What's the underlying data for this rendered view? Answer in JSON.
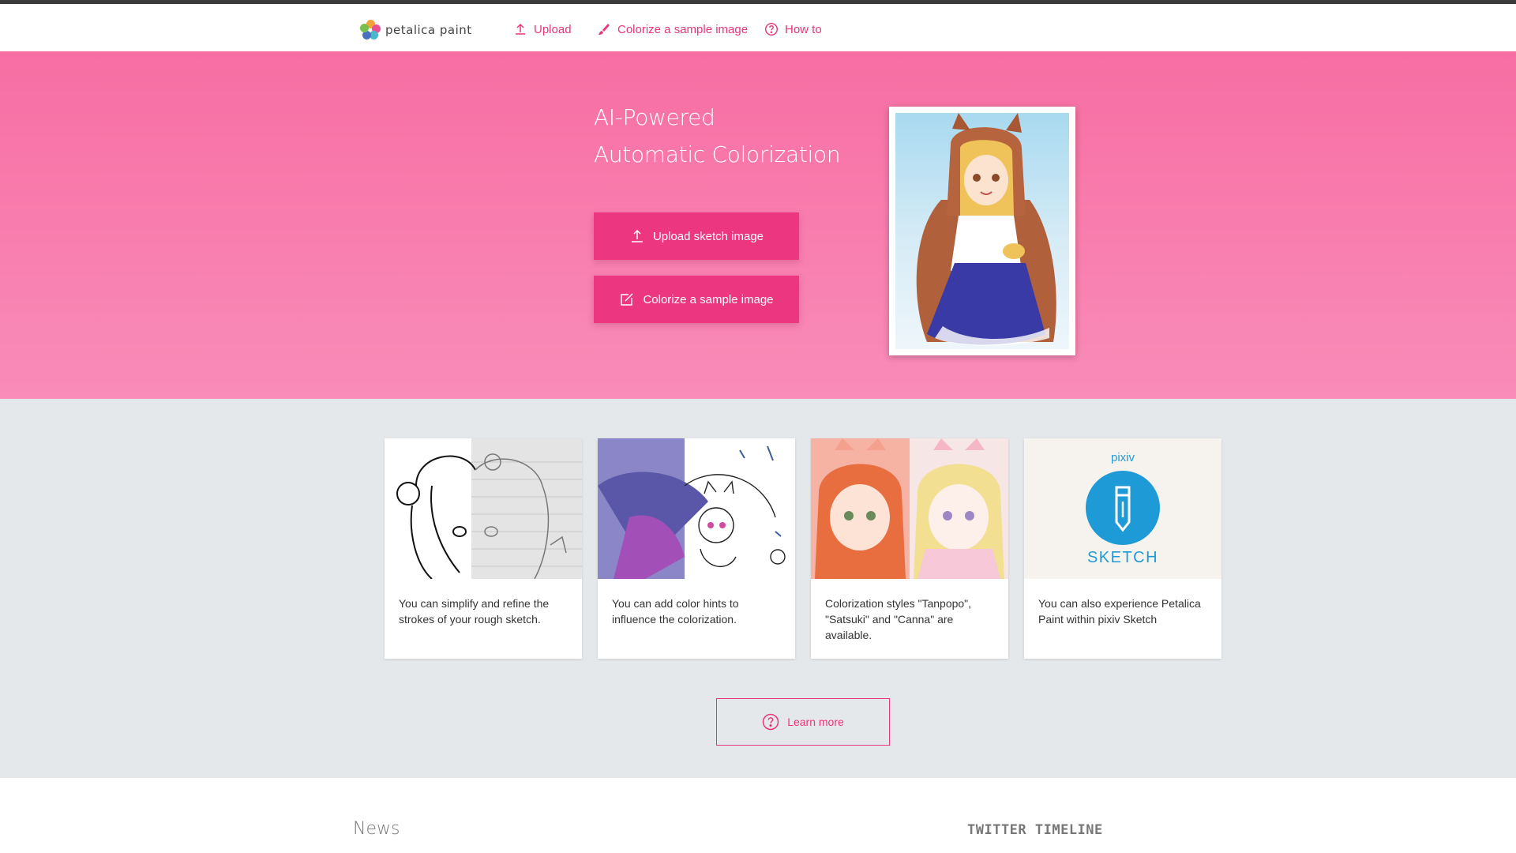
{
  "nav": {
    "logo_text": "petalica paint",
    "links": [
      {
        "label": "Upload",
        "icon": "upload-icon"
      },
      {
        "label": "Colorize a sample image",
        "icon": "brush-icon"
      },
      {
        "label": "How to",
        "icon": "question-circle-icon"
      }
    ]
  },
  "hero": {
    "title_line1": "AI-Powered",
    "title_line2": "Automatic Colorization",
    "upload_button": "Upload sketch image",
    "sample_button": "Colorize a sample image"
  },
  "features": {
    "cards": [
      {
        "text": "You can simplify and refine the strokes of your rough sketch."
      },
      {
        "text": "You can add color hints to influence the colorization."
      },
      {
        "text": "Colorization styles \"Tanpopo\", \"Satsuki\" and \"Canna\" are available."
      },
      {
        "text": "You can also experience Petalica Paint within pixiv Sketch",
        "brand_top": "pixiv",
        "brand_bottom": "SKETCH"
      }
    ],
    "learn_more": "Learn more"
  },
  "bottom": {
    "news_title": "News",
    "twitter_title": "TWITTER TIMELINE"
  },
  "colors": {
    "accent": "#e9357b",
    "hero_top": "#f76ea3",
    "hero_bottom": "#f98cb8",
    "button": "#ed3680",
    "features_bg": "#e5e8ea",
    "pixiv_blue": "#1e9bd7"
  }
}
